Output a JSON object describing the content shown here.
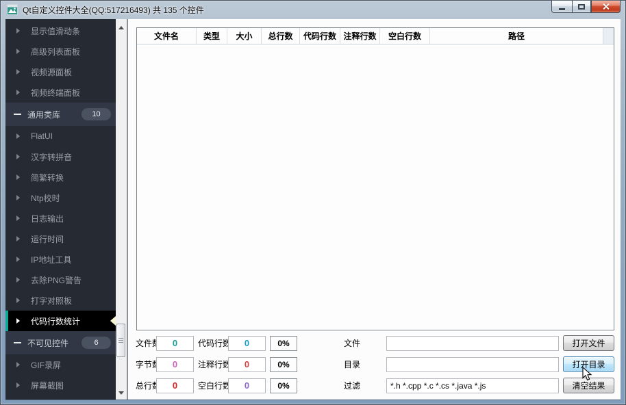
{
  "window": {
    "title": "Qt自定义控件大全(QQ:517216493) 共 135 个控件"
  },
  "sidebar": {
    "accent_color": "#0fa697",
    "items": [
      {
        "label": "显示值滑动条",
        "type": "child"
      },
      {
        "label": "高级列表面板",
        "type": "child"
      },
      {
        "label": "视频源面板",
        "type": "child"
      },
      {
        "label": "视频终端面板",
        "type": "child"
      },
      {
        "label": "通用类库",
        "type": "group",
        "badge": "10"
      },
      {
        "label": "FlatUI",
        "type": "child"
      },
      {
        "label": "汉字转拼音",
        "type": "child"
      },
      {
        "label": "简繁转换",
        "type": "child"
      },
      {
        "label": "Ntp校时",
        "type": "child"
      },
      {
        "label": "日志输出",
        "type": "child"
      },
      {
        "label": "运行时间",
        "type": "child"
      },
      {
        "label": "IP地址工具",
        "type": "child"
      },
      {
        "label": "去除PNG警告",
        "type": "child"
      },
      {
        "label": "打字对照板",
        "type": "child"
      },
      {
        "label": "代码行数统计",
        "type": "child",
        "selected": true
      },
      {
        "label": "不可见控件",
        "type": "group",
        "badge": "6"
      },
      {
        "label": "GIF录屏",
        "type": "child"
      },
      {
        "label": "屏幕截图",
        "type": "child"
      }
    ]
  },
  "table": {
    "columns": [
      "文件名",
      "类型",
      "大小",
      "总行数",
      "代码行数",
      "注释行数",
      "空白行数",
      "路径"
    ],
    "rows": []
  },
  "form": {
    "rows": [
      {
        "stat1_label": "文件数",
        "stat1_value": "0",
        "stat1_color": "#18a096",
        "stat2_label": "代码行数",
        "stat2_value": "0",
        "stat2_color": "#14a2c4",
        "percent": "0%",
        "path_label": "文件",
        "path_value": "",
        "button": "打开文件"
      },
      {
        "stat1_label": "字节数",
        "stat1_value": "0",
        "stat1_color": "#c765bd",
        "stat2_label": "注释行数",
        "stat2_value": "0",
        "stat2_color": "#d44343",
        "percent": "0%",
        "path_label": "目录",
        "path_value": "",
        "button": "打开目录"
      },
      {
        "stat1_label": "总行数",
        "stat1_value": "0",
        "stat1_color": "#d42626",
        "stat2_label": "空白行数",
        "stat2_value": "0",
        "stat2_color": "#8c6bc7",
        "percent": "0%",
        "path_label": "过滤",
        "path_value": "*.h *.cpp *.c *.cs *.java *.js",
        "button": "清空结果"
      }
    ]
  }
}
